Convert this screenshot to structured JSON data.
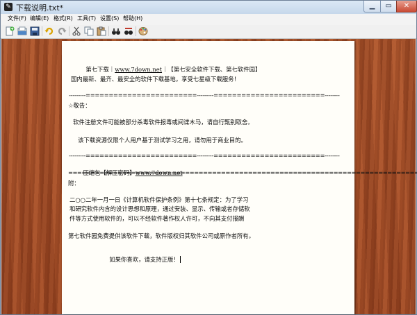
{
  "window": {
    "title": "下载说明.txt*"
  },
  "menu": [
    "文件(F)",
    "编辑(E)",
    "格式(R)",
    "工具(T)",
    "设置(S)",
    "帮助(H)"
  ],
  "toolbar": {
    "icons": [
      "new-icon",
      "open-icon",
      "save-icon",
      "undo-icon",
      "redo-icon",
      "cut-icon",
      "copy-icon",
      "paste-icon",
      "find-icon",
      "replace-icon",
      "palette-icon"
    ]
  },
  "doc": {
    "l1_pre": "第七下载｜",
    "l1_link": "www.7down.net",
    "l1_post": "｜【第七安全软件下载、第七软件园】",
    "l2": "国内最新、最齐、最安全的软件下载基地，享受七星级下载服务！",
    "l3": "---------========================---------========================--------",
    "l4": "☆敬告：",
    "l5": "软件注册文件可能被部分杀毒软件报毒或间谍木马，请自行甄别取舍。",
    "l6": "该下载资源仅限个人用户基于测试学习之用，请勿用于商业目的。",
    "l7": "---------========================---------========================--------",
    "l8_pre": "压缩包【解压密码】",
    "l8_link": "www.7down.net",
    "l9": "==============================================================================",
    "l10": "附：",
    "l11": "二○○二年一月一日《计算机软件保护条例》第十七条规定：为了学习",
    "l12": "和研究软件内含的设计思想和原理，通过安装、显示、传输或者存储软",
    "l13": "件等方式使用软件的，可以不经软件著作权人许可，不向其支付报酬",
    "l14": "第七软件园免费提供该软件下载，软件版权归其软件公司或原作者所有。",
    "l15": "如果你喜欢，请支持正版！"
  }
}
